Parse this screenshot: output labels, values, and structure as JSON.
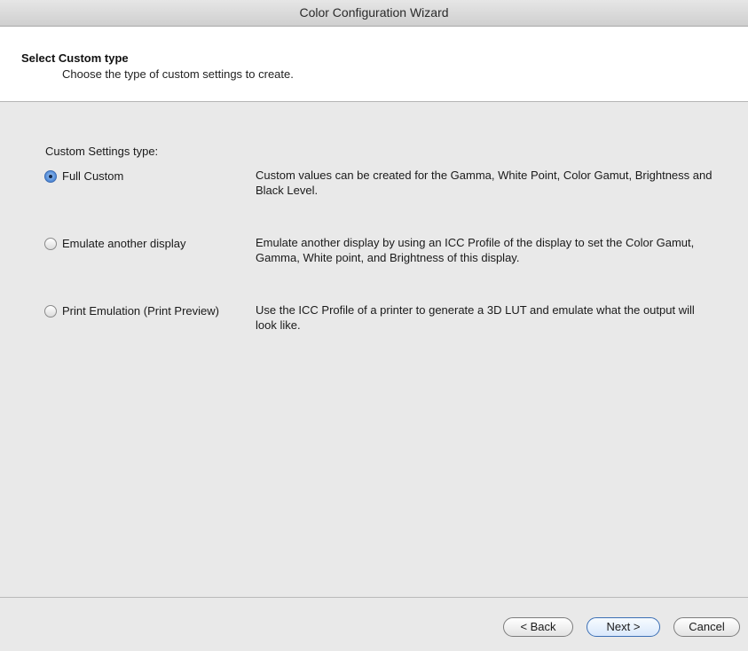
{
  "window": {
    "title": "Color Configuration Wizard"
  },
  "header": {
    "title": "Select Custom type",
    "subtitle": "Choose the type of custom settings to create."
  },
  "content": {
    "group_label": "Custom Settings type:",
    "options": [
      {
        "label": "Full Custom",
        "description": "Custom values can be created for the Gamma, White Point, Color Gamut, Brightness and Black Level.",
        "selected": true
      },
      {
        "label": "Emulate another display",
        "description": "Emulate another display by using an ICC Profile of the display to set the Color Gamut, Gamma, White point, and Brightness of this display.",
        "selected": false
      },
      {
        "label": "Print Emulation (Print Preview)",
        "description": "Use the ICC Profile of a printer to generate a 3D LUT and emulate what the output will look like.",
        "selected": false
      }
    ]
  },
  "footer": {
    "back_label": "< Back",
    "next_label": "Next >",
    "cancel_label": "Cancel"
  },
  "colors": {
    "accent": "#3b6bb3",
    "header_bg": "#ffffff",
    "window_bg": "#e9e9e9"
  }
}
